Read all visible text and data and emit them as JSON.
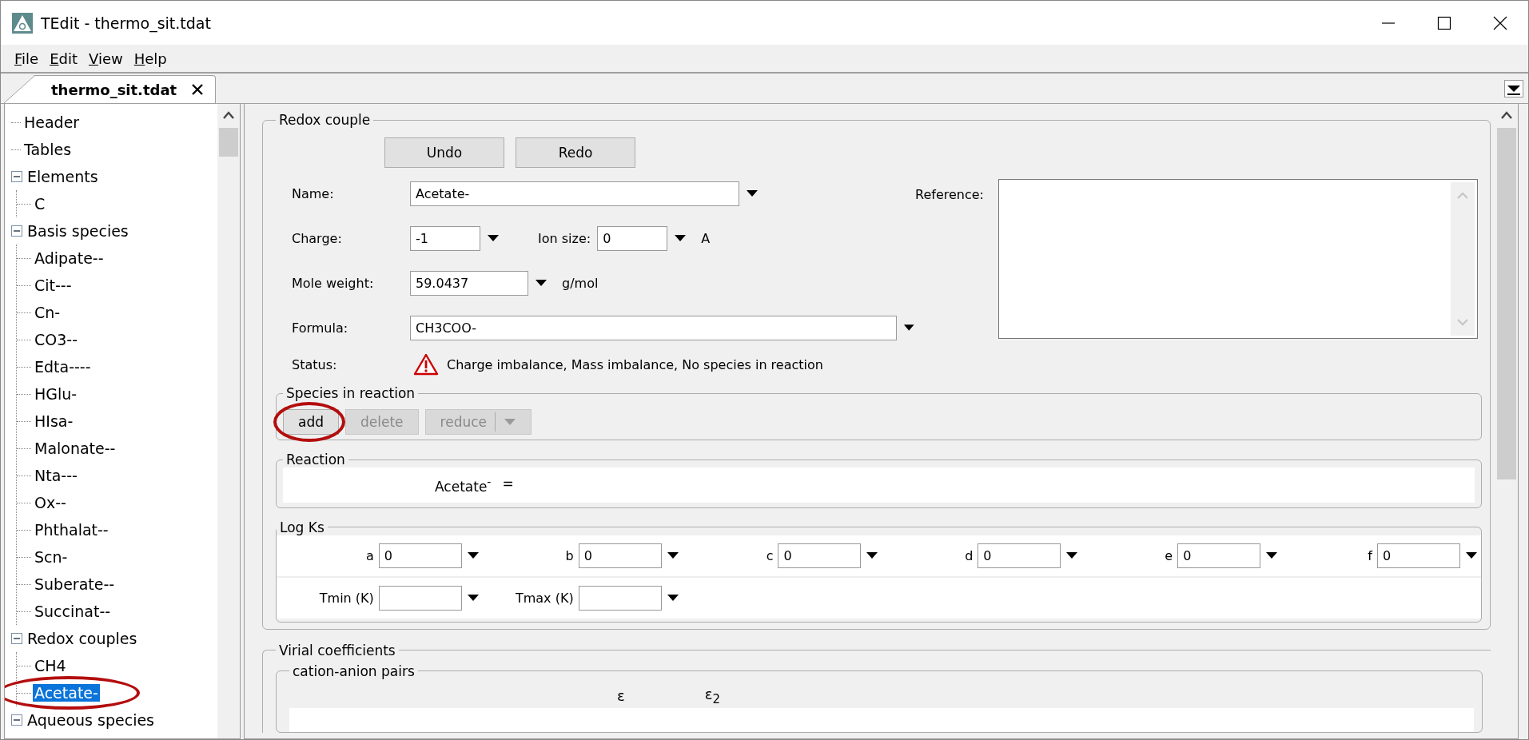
{
  "window": {
    "title": "TEdit - thermo_sit.tdat"
  },
  "menu": [
    {
      "label": "File"
    },
    {
      "label": "Edit"
    },
    {
      "label": "View"
    },
    {
      "label": "Help"
    }
  ],
  "tabs": [
    {
      "label": "thermo_sit.tdat",
      "selected": true
    }
  ],
  "tree": [
    {
      "label": "Header",
      "selected": false
    },
    {
      "label": "Tables",
      "selected": false
    },
    {
      "label": "Elements",
      "selected": false,
      "expanded": true,
      "children": [
        {
          "label": "C",
          "selected": false
        }
      ]
    },
    {
      "label": "Basis species",
      "selected": false,
      "expanded": true,
      "children": [
        {
          "label": "Adipate--",
          "selected": false
        },
        {
          "label": "Cit---",
          "selected": false
        },
        {
          "label": "Cn-",
          "selected": false
        },
        {
          "label": "CO3--",
          "selected": false
        },
        {
          "label": "Edta----",
          "selected": false
        },
        {
          "label": "HGlu-",
          "selected": false
        },
        {
          "label": "HIsa-",
          "selected": false
        },
        {
          "label": "Malonate--",
          "selected": false
        },
        {
          "label": "Nta---",
          "selected": false
        },
        {
          "label": "Ox--",
          "selected": false
        },
        {
          "label": "Phthalat--",
          "selected": false
        },
        {
          "label": "Scn-",
          "selected": false
        },
        {
          "label": "Suberate--",
          "selected": false
        },
        {
          "label": "Succinat--",
          "selected": false
        }
      ]
    },
    {
      "label": "Redox couples",
      "selected": false,
      "expanded": true,
      "children": [
        {
          "label": "CH4",
          "selected": false
        },
        {
          "label": "Acetate-",
          "selected": true,
          "circled": true
        }
      ]
    },
    {
      "label": "Aqueous species",
      "selected": false,
      "expanded": true
    }
  ],
  "redox_couple": {
    "legend": "Redox couple",
    "history_buttons": [
      {
        "label": "Undo",
        "disabled": false
      },
      {
        "label": "Redo",
        "disabled": false
      }
    ],
    "name": {
      "label": "Name:",
      "value": "Acetate-"
    },
    "charge": {
      "label": "Charge:",
      "value": "-1"
    },
    "ion_size": {
      "label": "Ion size:",
      "value": "0",
      "unit": "A"
    },
    "mole_weight": {
      "label": "Mole weight:",
      "value": "59.0437",
      "unit": "g/mol"
    },
    "formula": {
      "label": "Formula:",
      "value": "CH3COO-"
    },
    "reference": {
      "label": "Reference:"
    },
    "status": {
      "label": "Status:",
      "kind": "warning",
      "text": "Charge imbalance, Mass imbalance, No species in reaction"
    },
    "species": {
      "legend": "Species in reaction",
      "buttons": [
        {
          "label": "add",
          "disabled": false,
          "circled": true,
          "kind": "plain"
        },
        {
          "label": "delete",
          "disabled": true,
          "circled": false,
          "kind": "plain"
        },
        {
          "label": "reduce",
          "disabled": true,
          "circled": false,
          "kind": "split"
        }
      ]
    },
    "reaction": {
      "legend": "Reaction",
      "lhs": "Acetate$^{-}$",
      "sign": "="
    },
    "log_ks": {
      "legend": "Log Ks",
      "coefficients": [
        {
          "label": "a",
          "value": "0"
        },
        {
          "label": "b",
          "value": "0"
        },
        {
          "label": "c",
          "value": "0"
        },
        {
          "label": "d",
          "value": "0"
        },
        {
          "label": "e",
          "value": "0"
        },
        {
          "label": "f",
          "value": "0"
        }
      ],
      "temperatures": [
        {
          "label": "Tmin (K)"
        },
        {
          "label": "Tmax (K)"
        }
      ]
    }
  },
  "virial": {
    "legend": "Virial coefficients",
    "pairs": {
      "legend": "cation-anion pairs",
      "columns": [
        "ε",
        "ε$_{2}$"
      ]
    }
  }
}
